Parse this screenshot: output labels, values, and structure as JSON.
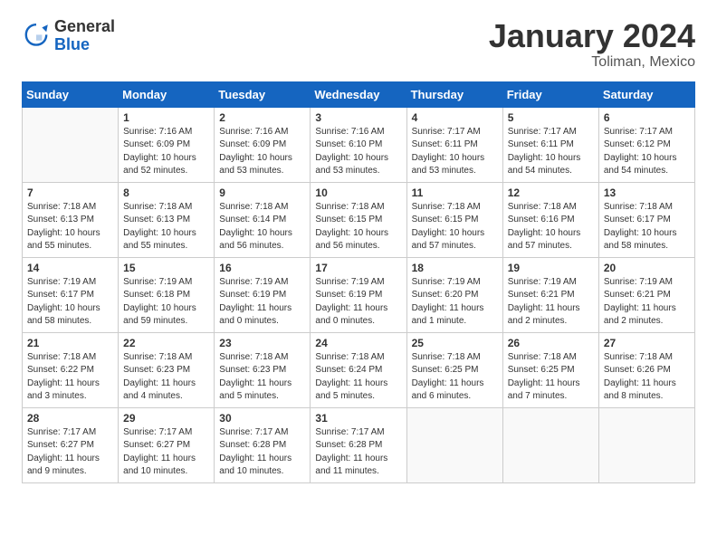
{
  "logo": {
    "general": "General",
    "blue": "Blue"
  },
  "title": "January 2024",
  "location": "Toliman, Mexico",
  "days_of_week": [
    "Sunday",
    "Monday",
    "Tuesday",
    "Wednesday",
    "Thursday",
    "Friday",
    "Saturday"
  ],
  "weeks": [
    [
      {
        "day": "",
        "empty": true
      },
      {
        "day": "1",
        "sunrise": "7:16 AM",
        "sunset": "6:09 PM",
        "daylight": "10 hours and 52 minutes."
      },
      {
        "day": "2",
        "sunrise": "7:16 AM",
        "sunset": "6:09 PM",
        "daylight": "10 hours and 53 minutes."
      },
      {
        "day": "3",
        "sunrise": "7:16 AM",
        "sunset": "6:10 PM",
        "daylight": "10 hours and 53 minutes."
      },
      {
        "day": "4",
        "sunrise": "7:17 AM",
        "sunset": "6:11 PM",
        "daylight": "10 hours and 53 minutes."
      },
      {
        "day": "5",
        "sunrise": "7:17 AM",
        "sunset": "6:11 PM",
        "daylight": "10 hours and 54 minutes."
      },
      {
        "day": "6",
        "sunrise": "7:17 AM",
        "sunset": "6:12 PM",
        "daylight": "10 hours and 54 minutes."
      }
    ],
    [
      {
        "day": "7",
        "sunrise": "7:18 AM",
        "sunset": "6:13 PM",
        "daylight": "10 hours and 55 minutes."
      },
      {
        "day": "8",
        "sunrise": "7:18 AM",
        "sunset": "6:13 PM",
        "daylight": "10 hours and 55 minutes."
      },
      {
        "day": "9",
        "sunrise": "7:18 AM",
        "sunset": "6:14 PM",
        "daylight": "10 hours and 56 minutes."
      },
      {
        "day": "10",
        "sunrise": "7:18 AM",
        "sunset": "6:15 PM",
        "daylight": "10 hours and 56 minutes."
      },
      {
        "day": "11",
        "sunrise": "7:18 AM",
        "sunset": "6:15 PM",
        "daylight": "10 hours and 57 minutes."
      },
      {
        "day": "12",
        "sunrise": "7:18 AM",
        "sunset": "6:16 PM",
        "daylight": "10 hours and 57 minutes."
      },
      {
        "day": "13",
        "sunrise": "7:18 AM",
        "sunset": "6:17 PM",
        "daylight": "10 hours and 58 minutes."
      }
    ],
    [
      {
        "day": "14",
        "sunrise": "7:19 AM",
        "sunset": "6:17 PM",
        "daylight": "10 hours and 58 minutes."
      },
      {
        "day": "15",
        "sunrise": "7:19 AM",
        "sunset": "6:18 PM",
        "daylight": "10 hours and 59 minutes."
      },
      {
        "day": "16",
        "sunrise": "7:19 AM",
        "sunset": "6:19 PM",
        "daylight": "11 hours and 0 minutes."
      },
      {
        "day": "17",
        "sunrise": "7:19 AM",
        "sunset": "6:19 PM",
        "daylight": "11 hours and 0 minutes."
      },
      {
        "day": "18",
        "sunrise": "7:19 AM",
        "sunset": "6:20 PM",
        "daylight": "11 hours and 1 minute."
      },
      {
        "day": "19",
        "sunrise": "7:19 AM",
        "sunset": "6:21 PM",
        "daylight": "11 hours and 2 minutes."
      },
      {
        "day": "20",
        "sunrise": "7:19 AM",
        "sunset": "6:21 PM",
        "daylight": "11 hours and 2 minutes."
      }
    ],
    [
      {
        "day": "21",
        "sunrise": "7:18 AM",
        "sunset": "6:22 PM",
        "daylight": "11 hours and 3 minutes."
      },
      {
        "day": "22",
        "sunrise": "7:18 AM",
        "sunset": "6:23 PM",
        "daylight": "11 hours and 4 minutes."
      },
      {
        "day": "23",
        "sunrise": "7:18 AM",
        "sunset": "6:23 PM",
        "daylight": "11 hours and 5 minutes."
      },
      {
        "day": "24",
        "sunrise": "7:18 AM",
        "sunset": "6:24 PM",
        "daylight": "11 hours and 5 minutes."
      },
      {
        "day": "25",
        "sunrise": "7:18 AM",
        "sunset": "6:25 PM",
        "daylight": "11 hours and 6 minutes."
      },
      {
        "day": "26",
        "sunrise": "7:18 AM",
        "sunset": "6:25 PM",
        "daylight": "11 hours and 7 minutes."
      },
      {
        "day": "27",
        "sunrise": "7:18 AM",
        "sunset": "6:26 PM",
        "daylight": "11 hours and 8 minutes."
      }
    ],
    [
      {
        "day": "28",
        "sunrise": "7:17 AM",
        "sunset": "6:27 PM",
        "daylight": "11 hours and 9 minutes."
      },
      {
        "day": "29",
        "sunrise": "7:17 AM",
        "sunset": "6:27 PM",
        "daylight": "11 hours and 10 minutes."
      },
      {
        "day": "30",
        "sunrise": "7:17 AM",
        "sunset": "6:28 PM",
        "daylight": "11 hours and 10 minutes."
      },
      {
        "day": "31",
        "sunrise": "7:17 AM",
        "sunset": "6:28 PM",
        "daylight": "11 hours and 11 minutes."
      },
      {
        "day": "",
        "empty": true
      },
      {
        "day": "",
        "empty": true
      },
      {
        "day": "",
        "empty": true
      }
    ]
  ]
}
